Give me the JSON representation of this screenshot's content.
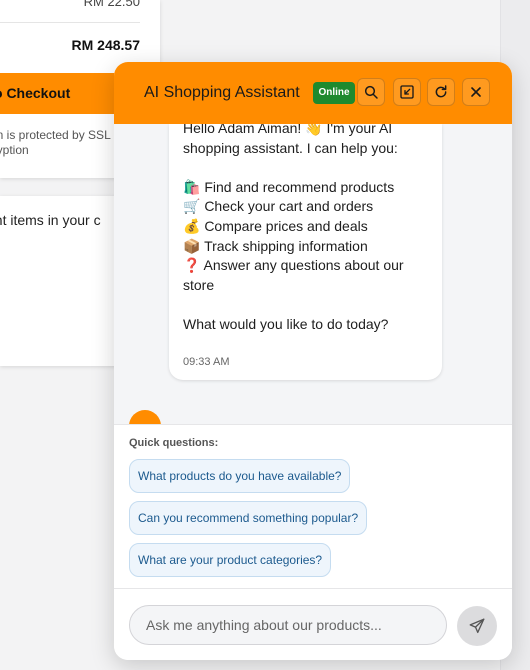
{
  "cart": {
    "subtotal_value": "RM 22.50",
    "total_value": "RM 248.57",
    "checkout_label": "o Checkout",
    "secure_line1": "on is protected by SSL",
    "secure_line2": "ncryption",
    "hint_text": "ght items in your c"
  },
  "chat": {
    "title": "AI Shopping Assistant",
    "status": "Online",
    "header_icons": [
      "search-icon",
      "minimize-icon",
      "refresh-icon",
      "close-icon"
    ],
    "colors": {
      "accent": "#ff8c00",
      "online": "#1e8a2e",
      "chip_text": "#1c5a8e"
    },
    "message": {
      "text": "Hello Adam Aiman! 👋 I'm your AI shopping assistant. I can help you:\n\n🛍️ Find and recommend products\n🛒 Check your cart and orders\n💰 Compare prices and deals\n📦 Track shipping information\n❓ Answer any questions about our store\n\nWhat would you like to do today?",
      "time": "09:33 AM"
    },
    "quick": {
      "title": "Quick questions:",
      "items": [
        "What products do you have available?",
        "Can you recommend something popular?",
        "What are your product categories?"
      ]
    },
    "input": {
      "placeholder": "Ask me anything about our products..."
    }
  }
}
